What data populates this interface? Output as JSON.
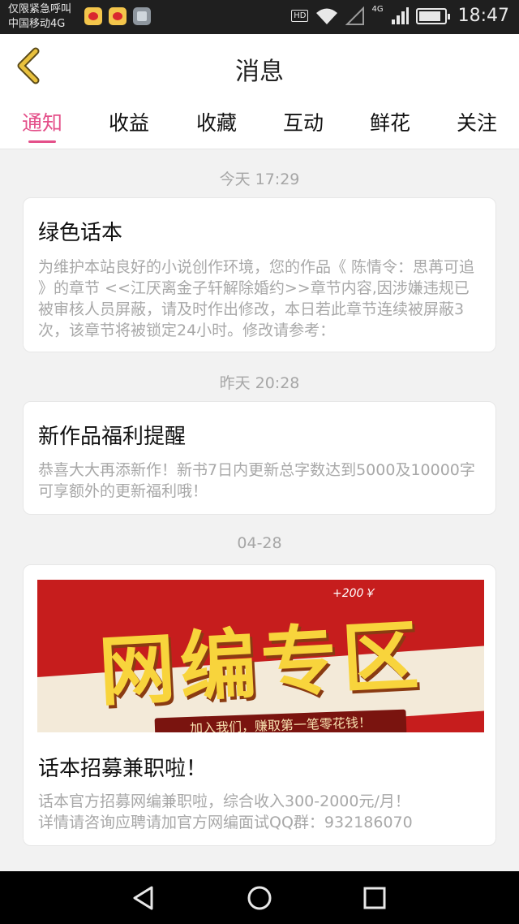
{
  "status_bar": {
    "line1": "仅限紧急呼叫",
    "line2": "中国移动4G",
    "hd_badge": "HD",
    "network": "4G",
    "time": "18:47"
  },
  "header": {
    "title": "消息"
  },
  "tabs": [
    {
      "label": "通知",
      "active": true
    },
    {
      "label": "收益"
    },
    {
      "label": "收藏"
    },
    {
      "label": "互动"
    },
    {
      "label": "鲜花"
    },
    {
      "label": "关注"
    }
  ],
  "feed": [
    {
      "date": "今天 17:29",
      "title": "绿色话本",
      "body": "为维护本站良好的小说创作环境，您的作品《 陈情令：思苒可追 》的章节 <<江厌离金子轩解除婚约>>章节内容,因涉嫌违规已被审核人员屏蔽，请及时作出修改，本日若此章节连续被屏蔽3次，该章节将被锁定24小时。修改请参考："
    },
    {
      "date": "昨天 20:28",
      "title": "新作品福利提醒",
      "body": "恭喜大大再添新作！新书7日内更新总字数达到5000及10000字可享额外的更新福利哦！"
    },
    {
      "date": "04-28",
      "title": "话本招募兼职啦！",
      "body_line1": "话本官方招募网编兼职啦，综合收入300-2000元/月！",
      "body_line2": "详情请咨询应聘请加官方网编面试QQ群：932186070",
      "banner": {
        "headline": "网编专区",
        "bonus": "+200￥",
        "ribbon": "加入我们，赚取第一笔零花钱！"
      }
    }
  ],
  "colors": {
    "accent": "#e4508a",
    "back_arrow": "#e9c13d"
  }
}
